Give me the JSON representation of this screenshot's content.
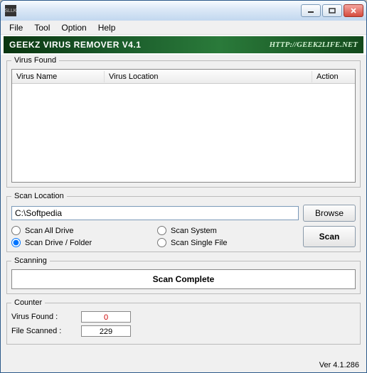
{
  "window": {
    "title": ""
  },
  "title_icon_text": "SLLK",
  "menubar": [
    "File",
    "Tool",
    "Option",
    "Help"
  ],
  "banner": {
    "title": "GEEKZ VIRUS REMOVER V4.1",
    "url": "HTTP://GEEK2LIFE.NET"
  },
  "virus_found": {
    "legend": "Virus Found",
    "columns": {
      "name": "Virus Name",
      "location": "Virus Location",
      "action": "Action"
    },
    "rows": []
  },
  "scan_location": {
    "legend": "Scan Location",
    "path": "C:\\Softpedia",
    "browse_label": "Browse",
    "scan_label": "Scan",
    "options": {
      "all_drive": "Scan All Drive",
      "drive_folder": "Scan Drive / Folder",
      "system": "Scan System",
      "single_file": "Scan Single File"
    },
    "selected": "drive_folder"
  },
  "scanning": {
    "legend": "Scanning",
    "status": "Scan Complete"
  },
  "counter": {
    "legend": "Counter",
    "virus_found_label": "Virus Found  :",
    "virus_found_value": "0",
    "file_scanned_label": "File Scanned  :",
    "file_scanned_value": "229"
  },
  "version": "Ver 4.1.286"
}
